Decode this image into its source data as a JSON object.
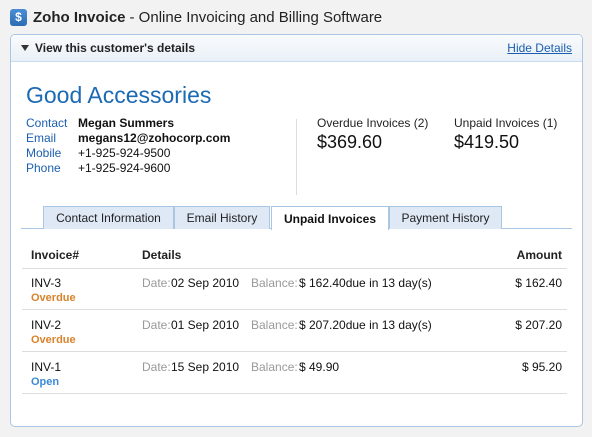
{
  "window": {
    "brand": "Zoho Invoice",
    "subtitle": "- Online Invoicing and Billing Software",
    "logo_letter": "$"
  },
  "panel": {
    "header": "View this customer's details",
    "hide_link": "Hide Details"
  },
  "customer": {
    "name": "Good Accessories",
    "contact": [
      {
        "label": "Contact",
        "value": "Megan Summers"
      },
      {
        "label": "Email",
        "value": "megans12@zohocorp.com"
      },
      {
        "label": "Mobile",
        "value": "+1-925-924-9500"
      },
      {
        "label": "Phone",
        "value": "+1-925-924-9600"
      }
    ]
  },
  "summary": {
    "overdue": {
      "label": "Overdue Invoices (2)",
      "amount": "$369.60"
    },
    "unpaid": {
      "label": "Unpaid Invoices (1)",
      "amount": "$419.50"
    }
  },
  "tabs": [
    {
      "label": "Contact Information",
      "active": false
    },
    {
      "label": "Email History",
      "active": false
    },
    {
      "label": "Unpaid Invoices",
      "active": true
    },
    {
      "label": "Payment History",
      "active": false
    }
  ],
  "table": {
    "headers": {
      "invoice": "Invoice#",
      "details": "Details",
      "amount": "Amount"
    },
    "date_label": "Date:",
    "balance_label": "Balance:",
    "rows": [
      {
        "invoice": "INV-3",
        "status": "Overdue",
        "date": "02 Sep 2010",
        "balance": "$ 162.40due in 13 day(s)",
        "amount": "$ 162.40"
      },
      {
        "invoice": "INV-2",
        "status": "Overdue",
        "date": "01 Sep 2010",
        "balance": "$ 207.20due in 13 day(s)",
        "amount": "$ 207.20"
      },
      {
        "invoice": "INV-1",
        "status": "Open",
        "date": "15 Sep 2010",
        "balance": "$ 49.90",
        "amount": "$ 95.20"
      }
    ]
  },
  "colors": {
    "accent": "#1b6ab4",
    "overdue": "#d9822b",
    "open": "#3b8ad6",
    "border": "#a9c7e3"
  }
}
